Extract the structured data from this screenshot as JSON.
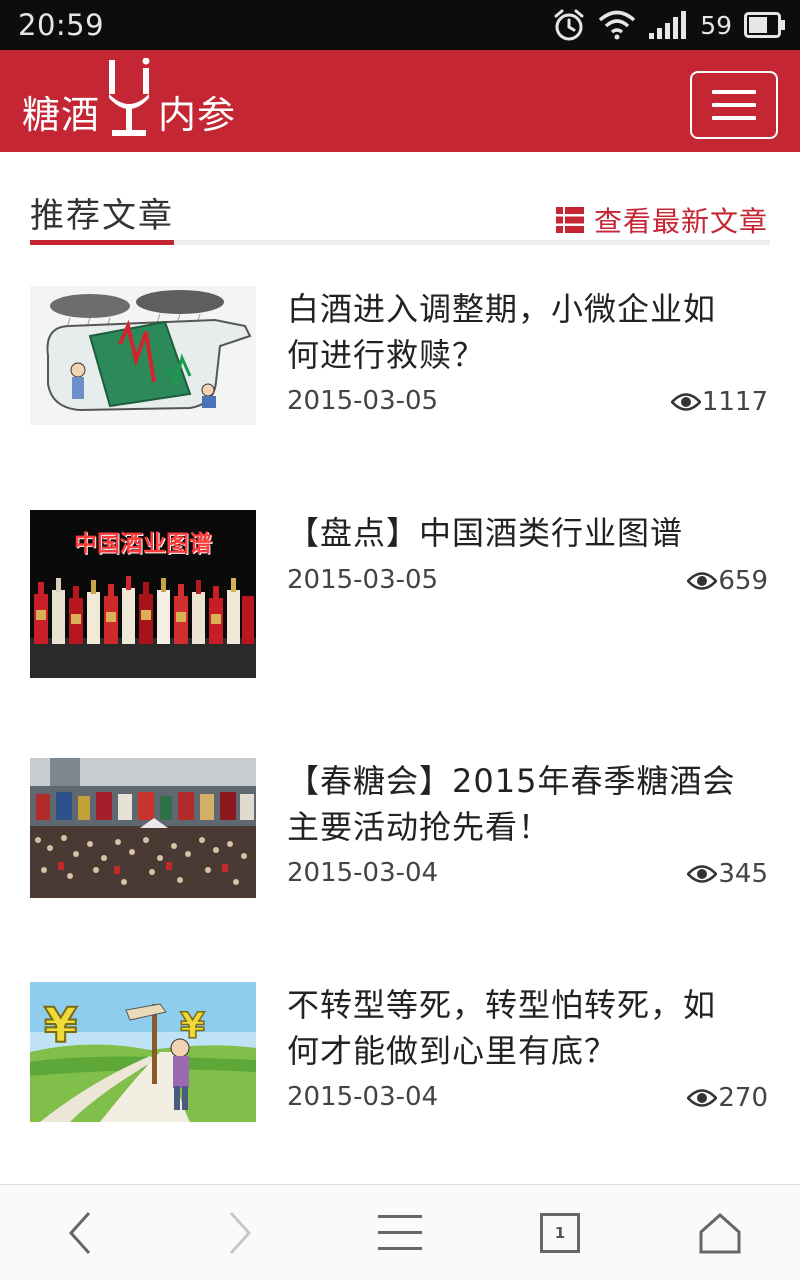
{
  "status_bar": {
    "time": "20:59",
    "battery_level": "59",
    "icons": [
      "alarm-icon",
      "wifi-icon",
      "signal-icon",
      "battery-icon"
    ]
  },
  "header": {
    "logo_left": "糖酒",
    "logo_right": "内参",
    "brand_color": "#c42633"
  },
  "section": {
    "title": "推荐文章",
    "latest_link": "查看最新文章"
  },
  "articles": [
    {
      "title_line1": "白酒进入调整期，小微企业如",
      "title_line2": "何进行救赎？",
      "date": "2015-03-05",
      "views": "1117"
    },
    {
      "title_line1": "【盘点】中国酒类行业图谱",
      "title_line2": "",
      "date": "2015-03-05",
      "views": "659",
      "image_caption": "中国酒业图谱"
    },
    {
      "title_line1": "【春糖会】2015年春季糖酒会",
      "title_line2": "主要活动抢先看！",
      "date": "2015-03-04",
      "views": "345"
    },
    {
      "title_line1": "不转型等死，转型怕转死，如",
      "title_line2": "何才能做到心里有底？",
      "date": "2015-03-04",
      "views": "270"
    }
  ],
  "browser_bar": {
    "tab_count": "1",
    "buttons": [
      "back-icon",
      "forward-icon",
      "menu-icon",
      "tabs-icon",
      "home-icon"
    ]
  }
}
